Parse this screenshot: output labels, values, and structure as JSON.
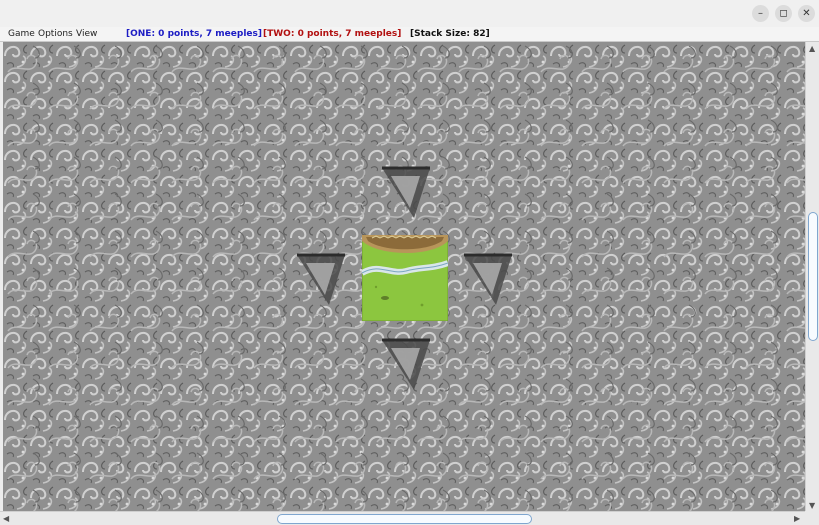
{
  "menu": {
    "game": "Game",
    "options": "Options",
    "view": "View"
  },
  "status": {
    "player_one": "[ONE: 0 points, 7 meeples]",
    "player_two": "[TWO: 0 points, 7 meeples]",
    "stack": "[Stack Size: 82]"
  },
  "colors": {
    "player_one": "#1c1cc4",
    "player_two": "#b21010",
    "stack": "#111111",
    "board_texture": "#8f8f8f",
    "grass": "#8cc63f",
    "river": "#d9e6ea"
  },
  "window_controls": {
    "minimize": "–",
    "maximize": "◻",
    "close": "✕"
  },
  "board": {
    "placed_tile": "river-tile-with-city-edge",
    "placement_options": [
      "north",
      "west",
      "east",
      "south"
    ]
  }
}
